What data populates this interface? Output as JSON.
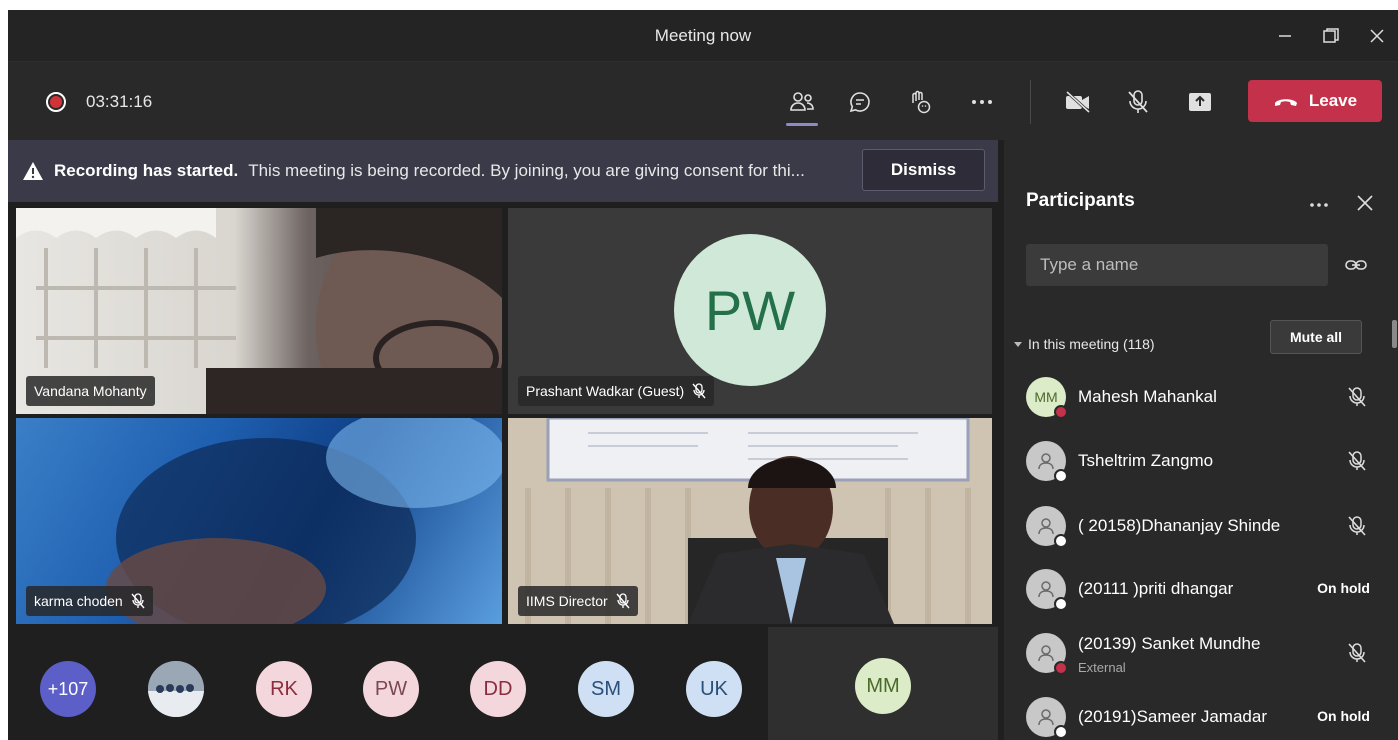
{
  "window": {
    "title": "Meeting now"
  },
  "toolbar": {
    "recording_time": "03:31:16",
    "leave_label": "Leave"
  },
  "banner": {
    "title": "Recording has started.",
    "text": "This meeting is being recorded. By joining, you are giving consent for thi...",
    "dismiss_label": "Dismiss"
  },
  "tiles": [
    {
      "name": "Vandana Mohanty"
    },
    {
      "name": "Prashant Wadkar (Guest)",
      "initials": "PW"
    },
    {
      "name": "karma choden"
    },
    {
      "name": "IIMS Director"
    }
  ],
  "strip": {
    "overflow": "+107",
    "chips": [
      "RK",
      "PW",
      "DD",
      "SM",
      "UK"
    ],
    "self_initials": "MM"
  },
  "panel": {
    "title": "Participants",
    "search_placeholder": "Type a name",
    "section_label": "In this meeting (118)",
    "mute_all_label": "Mute all",
    "participants": [
      {
        "initials": "MM",
        "name": "Mahesh Mahankal",
        "sub": "",
        "status": ""
      },
      {
        "initials": "",
        "name": "Tsheltrim Zangmo",
        "sub": "",
        "status": ""
      },
      {
        "initials": "",
        "name": "( 20158)Dhananjay Shinde",
        "sub": "",
        "status": ""
      },
      {
        "initials": "",
        "name": "(20111 )priti dhangar",
        "sub": "",
        "status": "On hold"
      },
      {
        "initials": "",
        "name": "(20139) Sanket Mundhe",
        "sub": "External",
        "status": ""
      },
      {
        "initials": "",
        "name": "(20191)Sameer Jamadar",
        "sub": "",
        "status": "On hold"
      }
    ]
  },
  "colors": {
    "leave": "#c4314b",
    "accent": "#8b8cc7",
    "recording": "#d13438",
    "banner": "#3b3a48"
  }
}
